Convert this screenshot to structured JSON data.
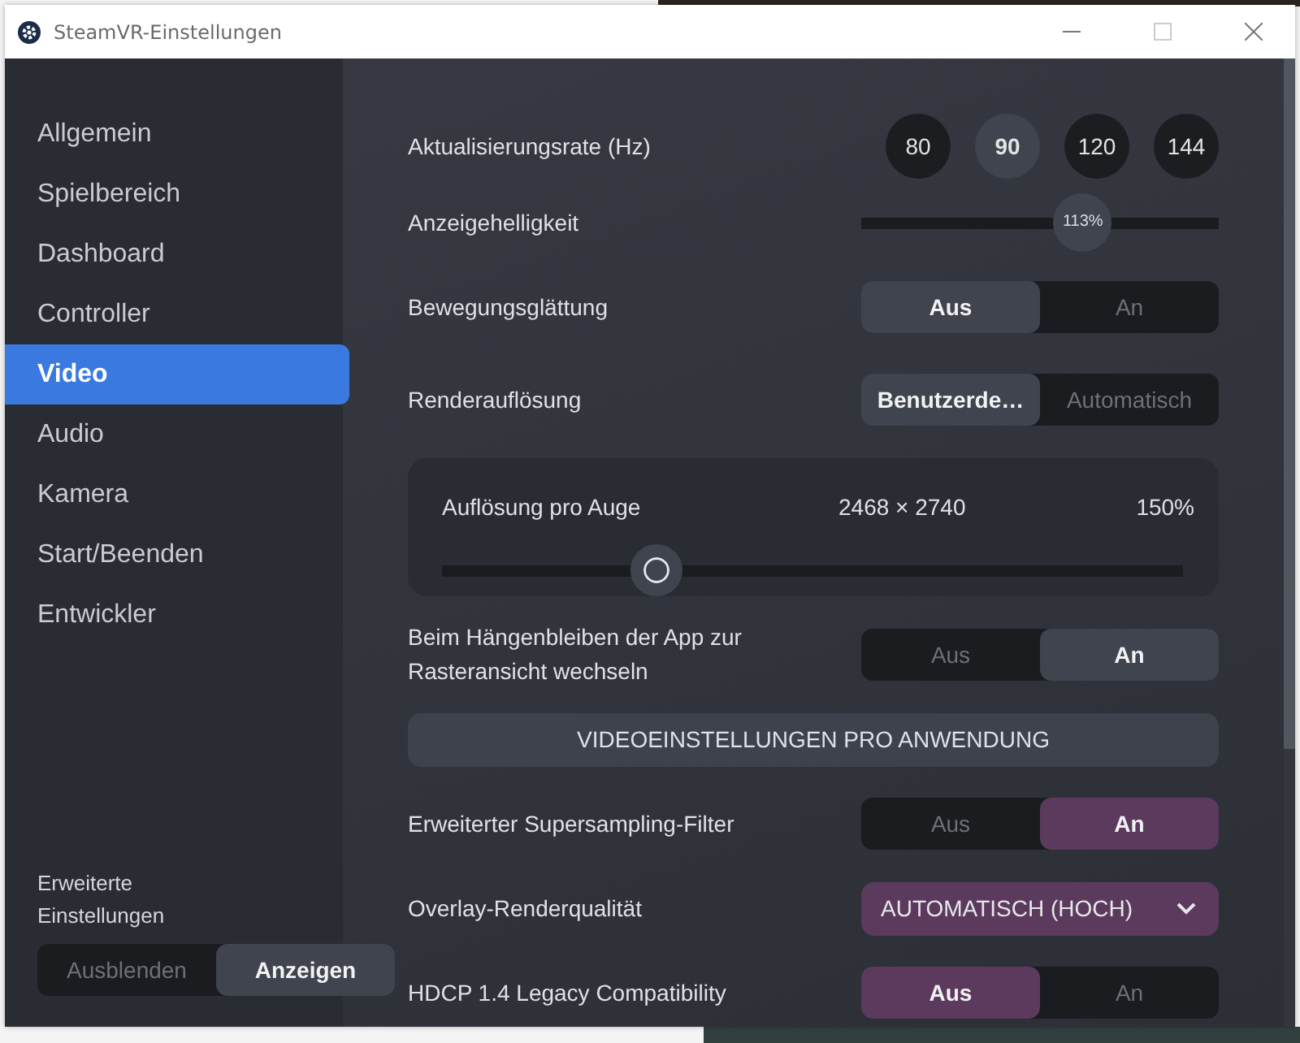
{
  "window": {
    "title": "SteamVR-Einstellungen"
  },
  "sidebar": {
    "items": [
      {
        "label": "Allgemein",
        "selected": false
      },
      {
        "label": "Spielbereich",
        "selected": false
      },
      {
        "label": "Dashboard",
        "selected": false
      },
      {
        "label": "Controller",
        "selected": false
      },
      {
        "label": "Video",
        "selected": true
      },
      {
        "label": "Audio",
        "selected": false
      },
      {
        "label": "Kamera",
        "selected": false
      },
      {
        "label": "Start/Beenden",
        "selected": false
      },
      {
        "label": "Entwickler",
        "selected": false
      }
    ],
    "advanced": {
      "label": "Erweiterte Einstellungen",
      "options": [
        {
          "label": "Ausblenden",
          "selected": false
        },
        {
          "label": "Anzeigen",
          "selected": true
        }
      ]
    }
  },
  "settings": [
    {
      "kind": "rate",
      "label": "Aktualisierungsrate (Hz)",
      "options": [
        {
          "label": "80",
          "selected": false
        },
        {
          "label": "90",
          "selected": true
        },
        {
          "label": "120",
          "selected": false
        },
        {
          "label": "144",
          "selected": false
        }
      ]
    },
    {
      "kind": "slider",
      "label": "Anzeigehelligkeit",
      "level": 0.62,
      "reading": "113%"
    },
    {
      "kind": "toggle",
      "label": "Bewegungsglättung",
      "modified": false,
      "options": [
        {
          "label": "Aus",
          "selected": true
        },
        {
          "label": "An",
          "selected": false
        }
      ]
    },
    {
      "kind": "toggle",
      "label": "Renderauflösung",
      "modified": false,
      "options": [
        {
          "label": "Benutzerde…",
          "selected": true
        },
        {
          "label": "Automatisch",
          "selected": false
        }
      ]
    },
    {
      "kind": "panel",
      "label": "Auflösung pro Auge",
      "resolution": "2468 × 2740",
      "reading": "150%",
      "level": 0.29
    },
    {
      "kind": "toggle",
      "label": "Beim Hängenbleiben der App zur Rasteransicht wechseln",
      "modified": false,
      "options": [
        {
          "label": "Aus",
          "selected": false
        },
        {
          "label": "An",
          "selected": true
        }
      ]
    },
    {
      "kind": "button",
      "label": "VIDEOEINSTELLUNGEN PRO ANWENDUNG"
    },
    {
      "kind": "toggle",
      "label": "Erweiterter Supersampling-Filter",
      "modified": true,
      "options": [
        {
          "label": "Aus",
          "selected": false
        },
        {
          "label": "An",
          "selected": true
        }
      ]
    },
    {
      "kind": "dropdown",
      "label": "Overlay-Renderqualität",
      "value": "AUTOMATISCH (HOCH)",
      "modified": true
    },
    {
      "kind": "toggle",
      "label": "HDCP 1.4 Legacy Compatibility",
      "modified": true,
      "options": [
        {
          "label": "Aus",
          "selected": true
        },
        {
          "label": "An",
          "selected": false
        }
      ]
    }
  ]
}
